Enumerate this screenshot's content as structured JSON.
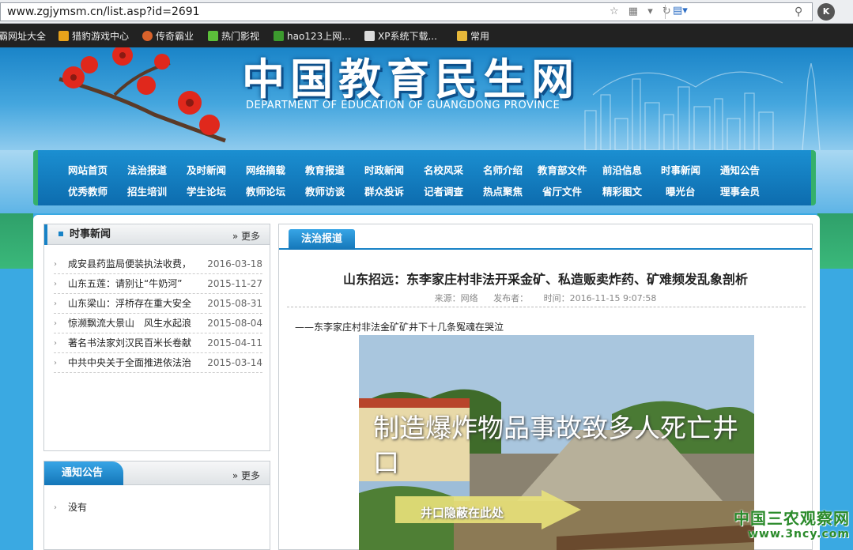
{
  "browser": {
    "url": "www.zgjymsm.cn/list.asp?id=2691",
    "ext_label": "K"
  },
  "bookmarks": [
    {
      "label": "霸网址大全",
      "icon": "globe-icon",
      "color": "#e34b3b"
    },
    {
      "label": "猎豹游戏中心",
      "icon": "game-icon",
      "color": "#e8a21b"
    },
    {
      "label": "传奇霸业",
      "icon": "game-icon",
      "color": "#d9622b"
    },
    {
      "label": "热门影视",
      "icon": "video-icon",
      "color": "#5bbf3a"
    },
    {
      "label": "hao123上网...",
      "icon": "hao-icon",
      "color": "#3c9a2e"
    },
    {
      "label": "XP系统下载...",
      "icon": "page-icon",
      "color": "#dcdcdc"
    },
    {
      "label": "常用",
      "icon": "folder-icon",
      "color": "#e7b83a"
    }
  ],
  "header": {
    "site_title": "中国教育民生网",
    "site_subtitle": "DEPARTMENT OF EDUCATION OF GUANGDONG PROVINCE"
  },
  "nav": {
    "row1": [
      "网站首页",
      "法治报道",
      "及时新闻",
      "网络摘载",
      "教育报道",
      "时政新闻",
      "名校风采",
      "名师介绍",
      "教育部文件",
      "前沿信息",
      "时事新闻",
      "通知公告"
    ],
    "row2": [
      "优秀教师",
      "招生培训",
      "学生论坛",
      "教师论坛",
      "教师访谈",
      "群众投诉",
      "记者调查",
      "热点聚焦",
      "省厅文件",
      "精彩图文",
      "曝光台",
      "理事会员"
    ]
  },
  "sidebar": {
    "news_box": {
      "title": "时事新闻",
      "more": "更多",
      "items": [
        {
          "title": "成安县药监局便装执法收费，",
          "date": "2016-03-18"
        },
        {
          "title": "山东五莲：请别让“牛奶河”",
          "date": "2015-11-27"
        },
        {
          "title": "山东梁山：浮桥存在重大安全",
          "date": "2015-08-31"
        },
        {
          "title": "惊濒飘流大景山　风生水起浪",
          "date": "2015-08-04"
        },
        {
          "title": "著名书法家刘汉民百米长卷献",
          "date": "2015-04-11"
        },
        {
          "title": "中共中央关于全面推进依法治",
          "date": "2015-03-14"
        }
      ]
    },
    "notice_box": {
      "title": "通知公告",
      "more": "更多",
      "items": [
        {
          "title": "没有"
        }
      ]
    }
  },
  "article": {
    "tab": "法治报道",
    "title": "山东招远：东李家庄村非法开采金矿、私造贩卖炸药、矿难频发乱象剖析",
    "source": "来源：网络",
    "publisher": "发布者：",
    "time": "时间：2016-11-15 9:07:58",
    "intro": "——东李家庄村非法金矿矿井下十几条冤魂在哭泣",
    "image_caption": "制造爆炸物品事故致多人死亡井口",
    "image_arrow_label": "井口隐蔽在此处"
  },
  "watermark": {
    "name": "中国三农观察网",
    "url": "www.3ncy.com"
  },
  "colors": {
    "nav_blue": "#0d6cae",
    "accent_blue": "#1782c6",
    "green": "#35b06a",
    "watermark_green": "#2a8a2a"
  }
}
